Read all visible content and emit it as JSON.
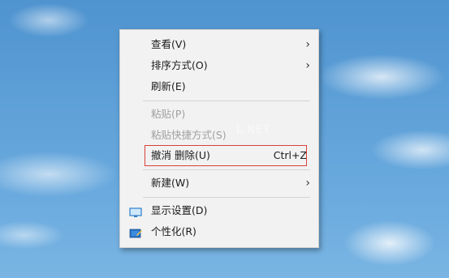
{
  "menu": {
    "items": [
      {
        "label": "查看(V)",
        "has_submenu": true
      },
      {
        "label": "排序方式(O)",
        "has_submenu": true
      },
      {
        "label": "刷新(E)"
      },
      {
        "label": "粘贴(P)",
        "disabled": true
      },
      {
        "label": "粘贴快捷方式(S)",
        "disabled": true
      },
      {
        "label": "撤消 删除(U)",
        "shortcut": "Ctrl+Z"
      },
      {
        "label": "新建(W)",
        "has_submenu": true
      },
      {
        "label": "显示设置(D)",
        "icon": "display-settings-icon"
      },
      {
        "label": "个性化(R)",
        "icon": "personalize-icon"
      }
    ],
    "submenu_arrow": "›",
    "highlight_color": "#d9413a"
  },
  "watermark": "L.NET"
}
